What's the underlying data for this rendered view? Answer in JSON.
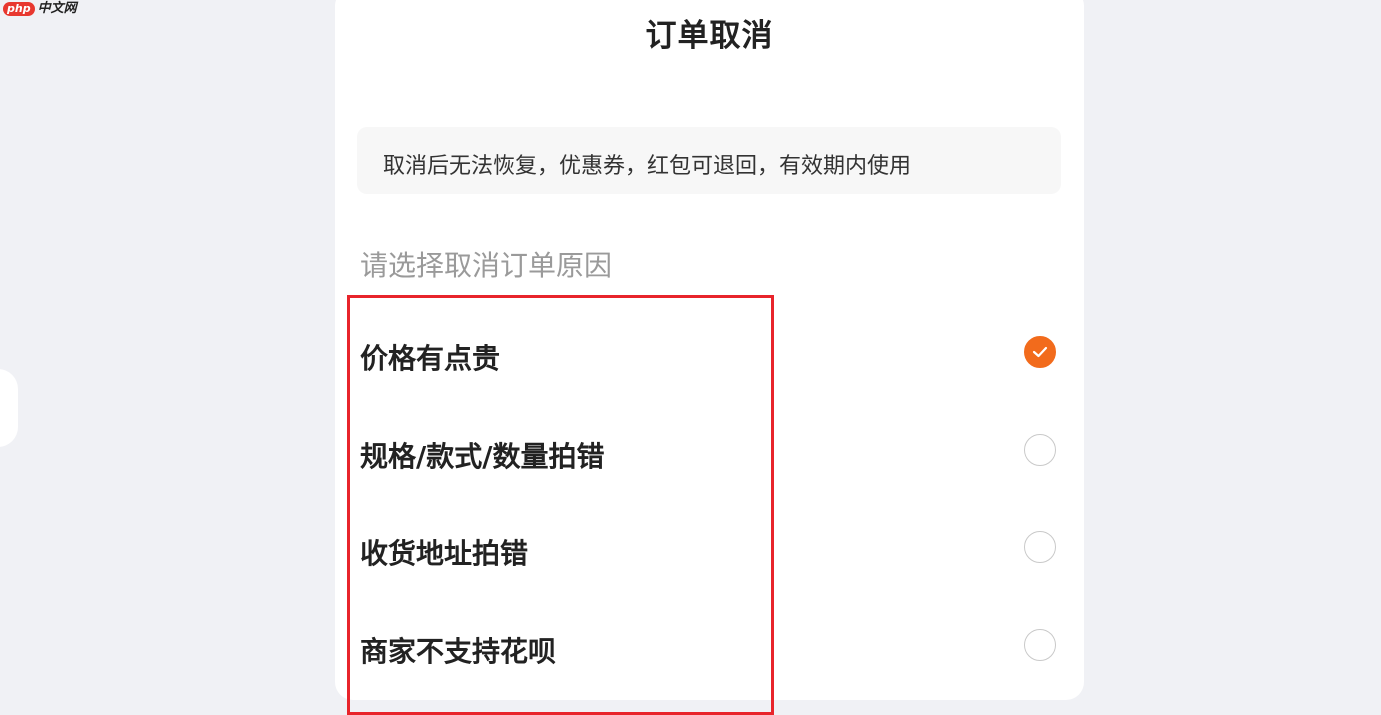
{
  "watermark": {
    "badge": "php",
    "text": "中文网"
  },
  "sheet": {
    "title": "订单取消",
    "notice": "取消后无法恢复，优惠券，红包可退回，有效期内使用",
    "reasons_heading": "请选择取消订单原因",
    "reasons": [
      {
        "label": "价格有点贵",
        "selected": true
      },
      {
        "label": "规格/款式/数量拍错",
        "selected": false
      },
      {
        "label": "收货地址拍错",
        "selected": false
      },
      {
        "label": "商家不支持花呗",
        "selected": false
      }
    ]
  },
  "colors": {
    "accent": "#f26b1c",
    "highlight_border": "#e8242b",
    "background": "#f0f1f5"
  }
}
